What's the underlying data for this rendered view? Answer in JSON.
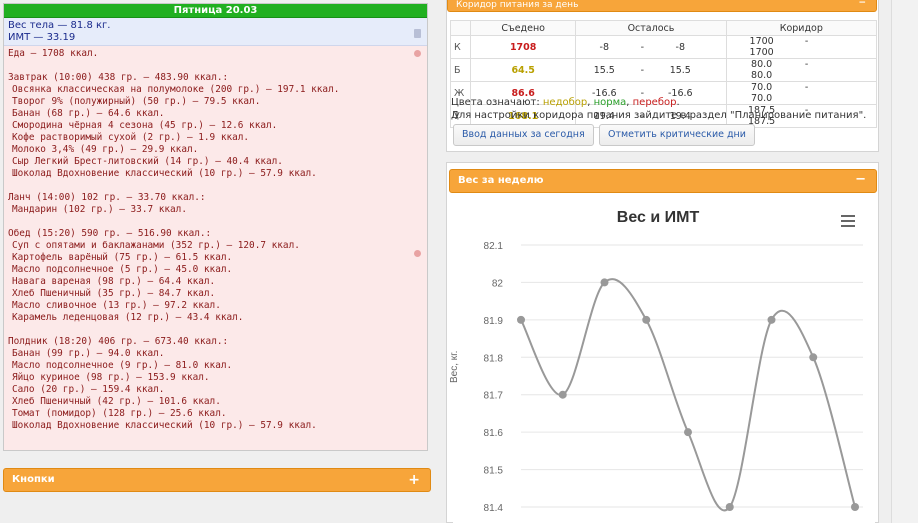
{
  "day": {
    "title": "Пятница 20.03"
  },
  "stats": {
    "weight": "Вес тела — 81.8 кг.",
    "bmi": "ИМТ — 33.19"
  },
  "food": {
    "total": "Еда — 1708 ккал.",
    "meals": [
      {
        "title": "Завтрак (10:00) 438 гр. — 483.90 ккал.:",
        "items": [
          "Овсянка классическая на полумолоке (200 гр.) — 197.1 ккал.",
          "Творог 9% (полужирный) (50 гр.) — 79.5 ккал.",
          "Банан (68 гр.) — 64.6 ккал.",
          "Смородина чёрная 4 сезона (45 гр.) — 12.6 ккал.",
          "Кофе растворимый сухой (2 гр.) — 1.9 ккал.",
          "Молоко 3,4% (49 гр.) — 29.9 ккал.",
          "Сыр Легкий Брест-литовский (14 гр.) — 40.4 ккал.",
          "Шоколад Вдохновение классический (10 гр.) — 57.9 ккал."
        ]
      },
      {
        "title": "Ланч (14:00) 102 гр. — 33.70 ккал.:",
        "items": [
          "Мандарин (102 гр.) — 33.7 ккал."
        ]
      },
      {
        "title": "Обед (15:20) 590 гр. — 516.90 ккал.:",
        "items": [
          "Суп с опятами и баклажанами (352 гр.) — 120.7 ккал.",
          "Картофель варёный (75 гр.) — 61.5 ккал.",
          "Масло подсолнечное (5 гр.) — 45.0 ккал.",
          "Навага вареная (98 гр.) — 64.4 ккал.",
          "Хлеб Пшеничный (35 гр.) — 84.7 ккал.",
          "Масло сливочное (13 гр.) — 97.2 ккал.",
          "Карамель леденцовая (12 гр.) — 43.4 ккал."
        ]
      },
      {
        "title": "Полдник (18:20) 406 гр. — 673.40 ккал.:",
        "items": [
          "Банан (99 гр.) — 94.0 ккал.",
          "Масло подсолнечное (9 гр.) — 81.0 ккал.",
          "Яйцо куриное (98 гр.) — 153.9 ккал.",
          "Сало (20 гр.) — 159.4 ккал.",
          "Хлеб Пшеничный (42 гр.) — 101.6 ккал.",
          "Томат (помидор) (128 гр.) — 25.6 ккал.",
          "Шоколад Вдохновение классический (10 гр.) — 57.9 ккал."
        ]
      }
    ]
  },
  "buttons_panel": {
    "title": "Кнопки",
    "icon": "+"
  },
  "corridor": {
    "title": "Коридор питания за день",
    "icon": "−",
    "headers": {
      "eaten": "Съедено",
      "left": "Осталось",
      "corridor": "Коридор"
    },
    "rows": [
      {
        "label": "К",
        "eaten": "1708",
        "eaten_color": "#c81c1c",
        "left_a": "-8",
        "left_b": "-8",
        "cor_a": "1700",
        "cor_b": "1700"
      },
      {
        "label": "Б",
        "eaten": "64.5",
        "eaten_color": "#b9a000",
        "left_a": "15.5",
        "left_b": "15.5",
        "cor_a": "80.0",
        "cor_b": "80.0"
      },
      {
        "label": "Ж",
        "eaten": "86.6",
        "eaten_color": "#c81c1c",
        "left_a": "-16.6",
        "left_b": "-16.6",
        "cor_a": "70.0",
        "cor_b": "70.0"
      },
      {
        "label": "У",
        "eaten": "168.1",
        "eaten_color": "#b9a000",
        "left_a": "19.4",
        "left_b": "19.4",
        "cor_a": "187.5",
        "cor_b": "187.5"
      }
    ],
    "dash": "-",
    "legend_prefix": "Цвета означают: ",
    "legend_under": "недобор",
    "legend_norm": "норма",
    "legend_over": "перебор",
    "legend_sep1": ", ",
    "legend_sep2": ", ",
    "legend_end": ".",
    "hint": "Для настройки коридора питания зайдите в раздел \"Планирование питания\".",
    "btn_today": "Ввод данных за сегодня",
    "btn_critical": "Отметить критические дни"
  },
  "week": {
    "title": "Вес за неделю",
    "icon": "−"
  },
  "chart_data": {
    "type": "line",
    "title": "Вес и ИМТ",
    "ylabel": "Вес, кг.",
    "ylim": [
      81.4,
      82.1
    ],
    "yticks": [
      "82.1",
      "82",
      "81.9",
      "81.8",
      "81.7",
      "81.6",
      "81.5",
      "81.4"
    ],
    "grid": true,
    "series": [
      {
        "values": [
          81.9,
          81.7,
          82.0,
          81.9,
          81.6,
          81.4,
          81.9,
          81.8,
          81.4
        ],
        "color": "#999999"
      }
    ]
  }
}
